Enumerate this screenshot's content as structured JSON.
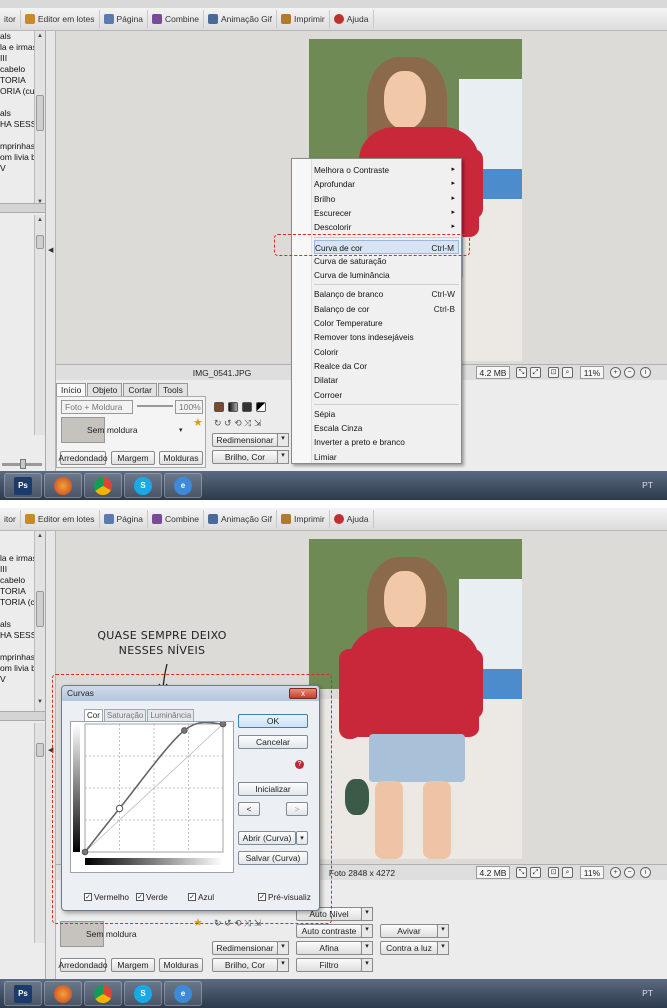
{
  "toolbar": {
    "items": [
      "itor",
      "Editor em lotes",
      "Página",
      "Combine",
      "Animação Gif",
      "Imprimir",
      "Ajuda"
    ],
    "icon_colors": [
      "#8a8a8a",
      "#c98a2a",
      "#5a7ab0",
      "#7a4a9a",
      "#4a6a9a",
      "#b07a30",
      "#c03030"
    ]
  },
  "sidebar": {
    "top_items": [
      "als",
      "",
      "la e irmas",
      "III",
      "cabelo",
      "TORIA",
      "ORIA (cu",
      "",
      "als",
      "HA SESSÃ",
      "",
      "mprinhas",
      "om livia br",
      "V"
    ],
    "bottom_items": [
      "la e irmas",
      "III",
      "cabelo",
      "TORIA",
      "TORIA (cu",
      "",
      "als",
      "HA SESSÃ",
      "",
      "mprinhas",
      "om livia br",
      "V"
    ]
  },
  "panel1": {
    "filename": "IMG_0541.JPG",
    "file_size": "4.2 MB",
    "zoom": "11%",
    "tabs": [
      "Início",
      "Objeto",
      "Cortar",
      "Tools"
    ],
    "frame_field": "Foto + Moldura",
    "frame_percent": "100%",
    "frame_combo": "Sem moldura",
    "buttons": {
      "rounded": "Arredondado",
      "margin": "Margem",
      "frames": "Molduras",
      "resize": "Redimensionar",
      "brightness_color": "Brilho, Cor"
    },
    "menu": [
      {
        "label": "Melhora o Contraste",
        "shortcut": "",
        "submenu": true
      },
      {
        "label": "Aprofundar",
        "shortcut": "",
        "submenu": true
      },
      {
        "label": "Brilho",
        "shortcut": "",
        "submenu": true
      },
      {
        "label": "Escurecer",
        "shortcut": "",
        "submenu": true
      },
      {
        "label": "Descolorir",
        "shortcut": "",
        "submenu": true
      },
      {
        "label": "Curva de cor",
        "shortcut": "Ctrl-M",
        "submenu": false,
        "highlighted": true
      },
      {
        "label": "Curva de saturação",
        "shortcut": "",
        "submenu": false
      },
      {
        "label": "Curva de luminância",
        "shortcut": "",
        "submenu": false
      },
      {
        "label": "Balanço de branco",
        "shortcut": "Ctrl-W",
        "submenu": false
      },
      {
        "label": "Balanço de cor",
        "shortcut": "Ctrl-B",
        "submenu": false
      },
      {
        "label": "Color Temperature",
        "shortcut": "",
        "submenu": false
      },
      {
        "label": "Remover tons indesejáveis",
        "shortcut": "",
        "submenu": false
      },
      {
        "label": "Colorir",
        "shortcut": "",
        "submenu": false
      },
      {
        "label": "Realce da Cor",
        "shortcut": "",
        "submenu": false
      },
      {
        "label": "Dilatar",
        "shortcut": "",
        "submenu": false
      },
      {
        "label": "Corroer",
        "shortcut": "",
        "submenu": false
      },
      {
        "label": "Sépia",
        "shortcut": "",
        "submenu": false
      },
      {
        "label": "Escala Cinza",
        "shortcut": "",
        "submenu": false
      },
      {
        "label": "Inverter a preto e branco",
        "shortcut": "",
        "submenu": false
      },
      {
        "label": "Limiar",
        "shortcut": "",
        "submenu": false
      }
    ]
  },
  "panel2": {
    "annotation_line1": "QUASE SEMPRE DEIXO",
    "annotation_line2": "NESSES NÍVEIS",
    "photo_info": "Foto 2848 x 4272",
    "file_size": "4.2 MB",
    "zoom": "11%",
    "frame_combo": "Sem moldura",
    "buttons": {
      "rounded": "Arredondado",
      "margin": "Margem",
      "frames": "Molduras",
      "resize": "Redimensionar",
      "brightness_color": "Brilho, Cor",
      "auto_level": "Auto Nível",
      "auto_contrast": "Auto contraste",
      "sharpen": "Afina",
      "filter": "Filtro",
      "enliven": "Avivar",
      "backlight": "Contra a luz"
    },
    "dialog": {
      "title": "Curvas",
      "close": "x",
      "tabs": [
        "Cor",
        "Saturação",
        "Luminância"
      ],
      "buttons": {
        "ok": "OK",
        "cancel": "Cancelar",
        "reset": "Inicializar",
        "prev": "<",
        "next": ">",
        "open_curve": "Abrir (Curva)",
        "save_curve": "Salvar (Curva)"
      },
      "checkboxes": [
        {
          "label": "Vermelho",
          "checked": true
        },
        {
          "label": "Verde",
          "checked": true
        },
        {
          "label": "Azul",
          "checked": true
        },
        {
          "label": "Pré-visualiz",
          "checked": true
        }
      ],
      "curve_points": [
        {
          "input": 0,
          "output": 0
        },
        {
          "input": 0.25,
          "output": 0.34
        },
        {
          "input": 0.72,
          "output": 0.95
        },
        {
          "input": 1,
          "output": 1
        }
      ]
    }
  },
  "taskbar": {
    "apps": [
      "Photoshop",
      "Firefox",
      "Chrome",
      "Skype",
      "Internet Explorer"
    ],
    "ps_label": "Ps",
    "s_label": "S",
    "ie_label": "e",
    "lang": "PT"
  },
  "colors": {
    "callout": "#d42b2b",
    "menu_highlight": "#d8e4f4",
    "red_top": "#c9283b"
  }
}
